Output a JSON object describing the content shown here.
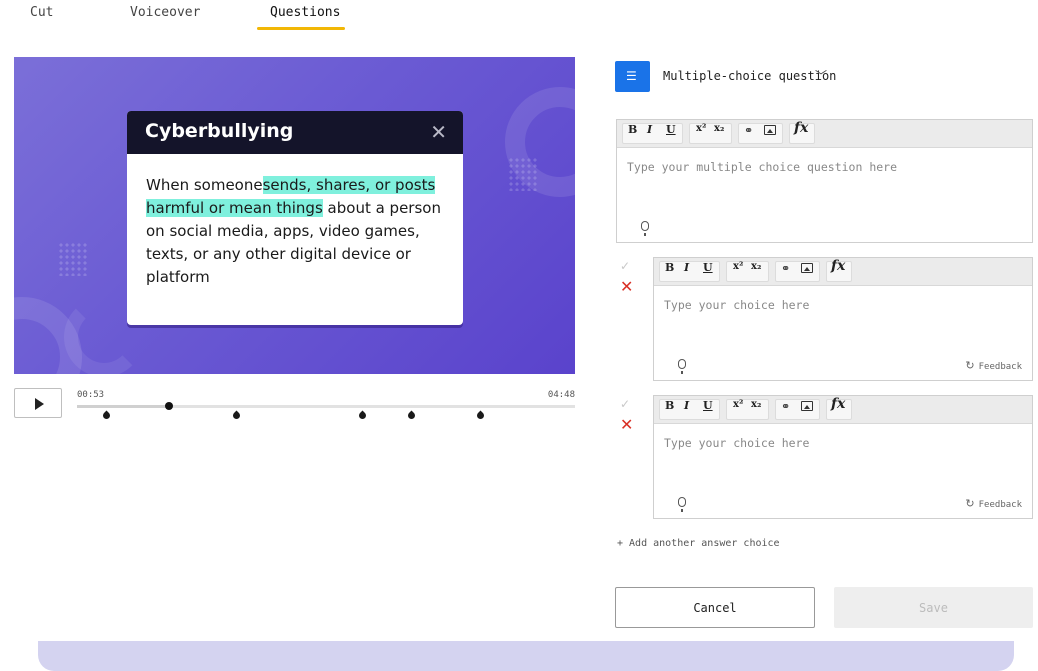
{
  "tabs": [
    {
      "label": "Cut"
    },
    {
      "label": "Voiceover"
    },
    {
      "label": "Questions",
      "active": true
    }
  ],
  "video": {
    "card_title": "Cyberbullying",
    "card_text_before": "When someone",
    "card_text_highlight": "sends, shares, or posts harmful or mean things",
    "card_text_after": "about a person on social media, apps, video games, texts, or any other digital device or platform",
    "highlight_color": "#7ff0dd"
  },
  "player": {
    "current_time": "00:53",
    "total_time": "04:48",
    "current_seconds": 53,
    "total_seconds": 288,
    "question_markers_seconds": [
      17,
      92,
      165,
      193,
      233
    ]
  },
  "question": {
    "type_label": "Multiple-choice question",
    "placeholder": "Type your multiple choice question here",
    "choices": [
      {
        "placeholder": "Type your choice here",
        "feedback_label": "Feedback",
        "correct": false
      },
      {
        "placeholder": "Type your choice here",
        "feedback_label": "Feedback",
        "correct": false
      }
    ],
    "add_choice_label": "+ Add another answer choice"
  },
  "toolbar": {
    "bold": "B",
    "italic": "I",
    "underline": "U",
    "superscript": "x²",
    "subscript": "x₂",
    "formula": "fx"
  },
  "actions": {
    "cancel_label": "Cancel",
    "save_label": "Save"
  },
  "colors": {
    "accent": "#1a73e8",
    "tab_underline": "#f2b705",
    "incorrect": "#d93025"
  }
}
